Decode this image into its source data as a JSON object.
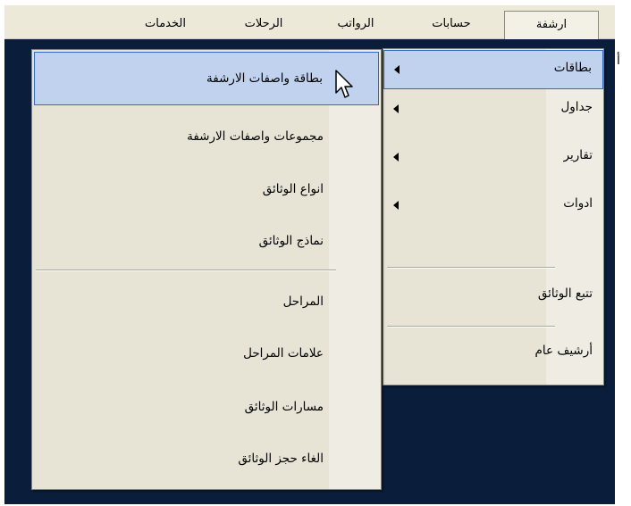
{
  "menubar": {
    "items": [
      {
        "label": "ارشفة",
        "active": true
      },
      {
        "label": "حسابات"
      },
      {
        "label": "الرواتب"
      },
      {
        "label": "الرحلات"
      },
      {
        "label": "الخدمات"
      }
    ]
  },
  "peek_text": "أ",
  "archive_menu": {
    "items": [
      {
        "label": "بطاقات",
        "has_submenu": true,
        "highlighted": true
      },
      {
        "label": "جداول",
        "has_submenu": true
      },
      {
        "label": "تقارير",
        "has_submenu": true
      },
      {
        "label": "ادوات",
        "has_submenu": true
      },
      {
        "label": "تتبع الوثائق"
      },
      {
        "label": "أرشيف عام"
      }
    ]
  },
  "cards_submenu": {
    "items": [
      {
        "label": "بطاقة واصفات الارشفة",
        "highlighted": true
      },
      {
        "label": "مجموعات واصفات الارشفة"
      },
      {
        "label": "انواع الوثائق"
      },
      {
        "label": "نماذج الوثائق"
      },
      {
        "label": "المراحل"
      },
      {
        "label": "علامات المراحل"
      },
      {
        "label": "مسارات الوثائق"
      },
      {
        "label": "الغاء حجز الوثائق"
      }
    ]
  },
  "colors": {
    "menubar_bg": "#ece9d8",
    "app_bg": "#0a1e3c",
    "highlight_bg": "#c1d2ee",
    "highlight_border": "#316ac5"
  },
  "icons": {
    "cursor": "mouse-pointer-icon",
    "submenu_arrow": "triangle-left-icon"
  }
}
